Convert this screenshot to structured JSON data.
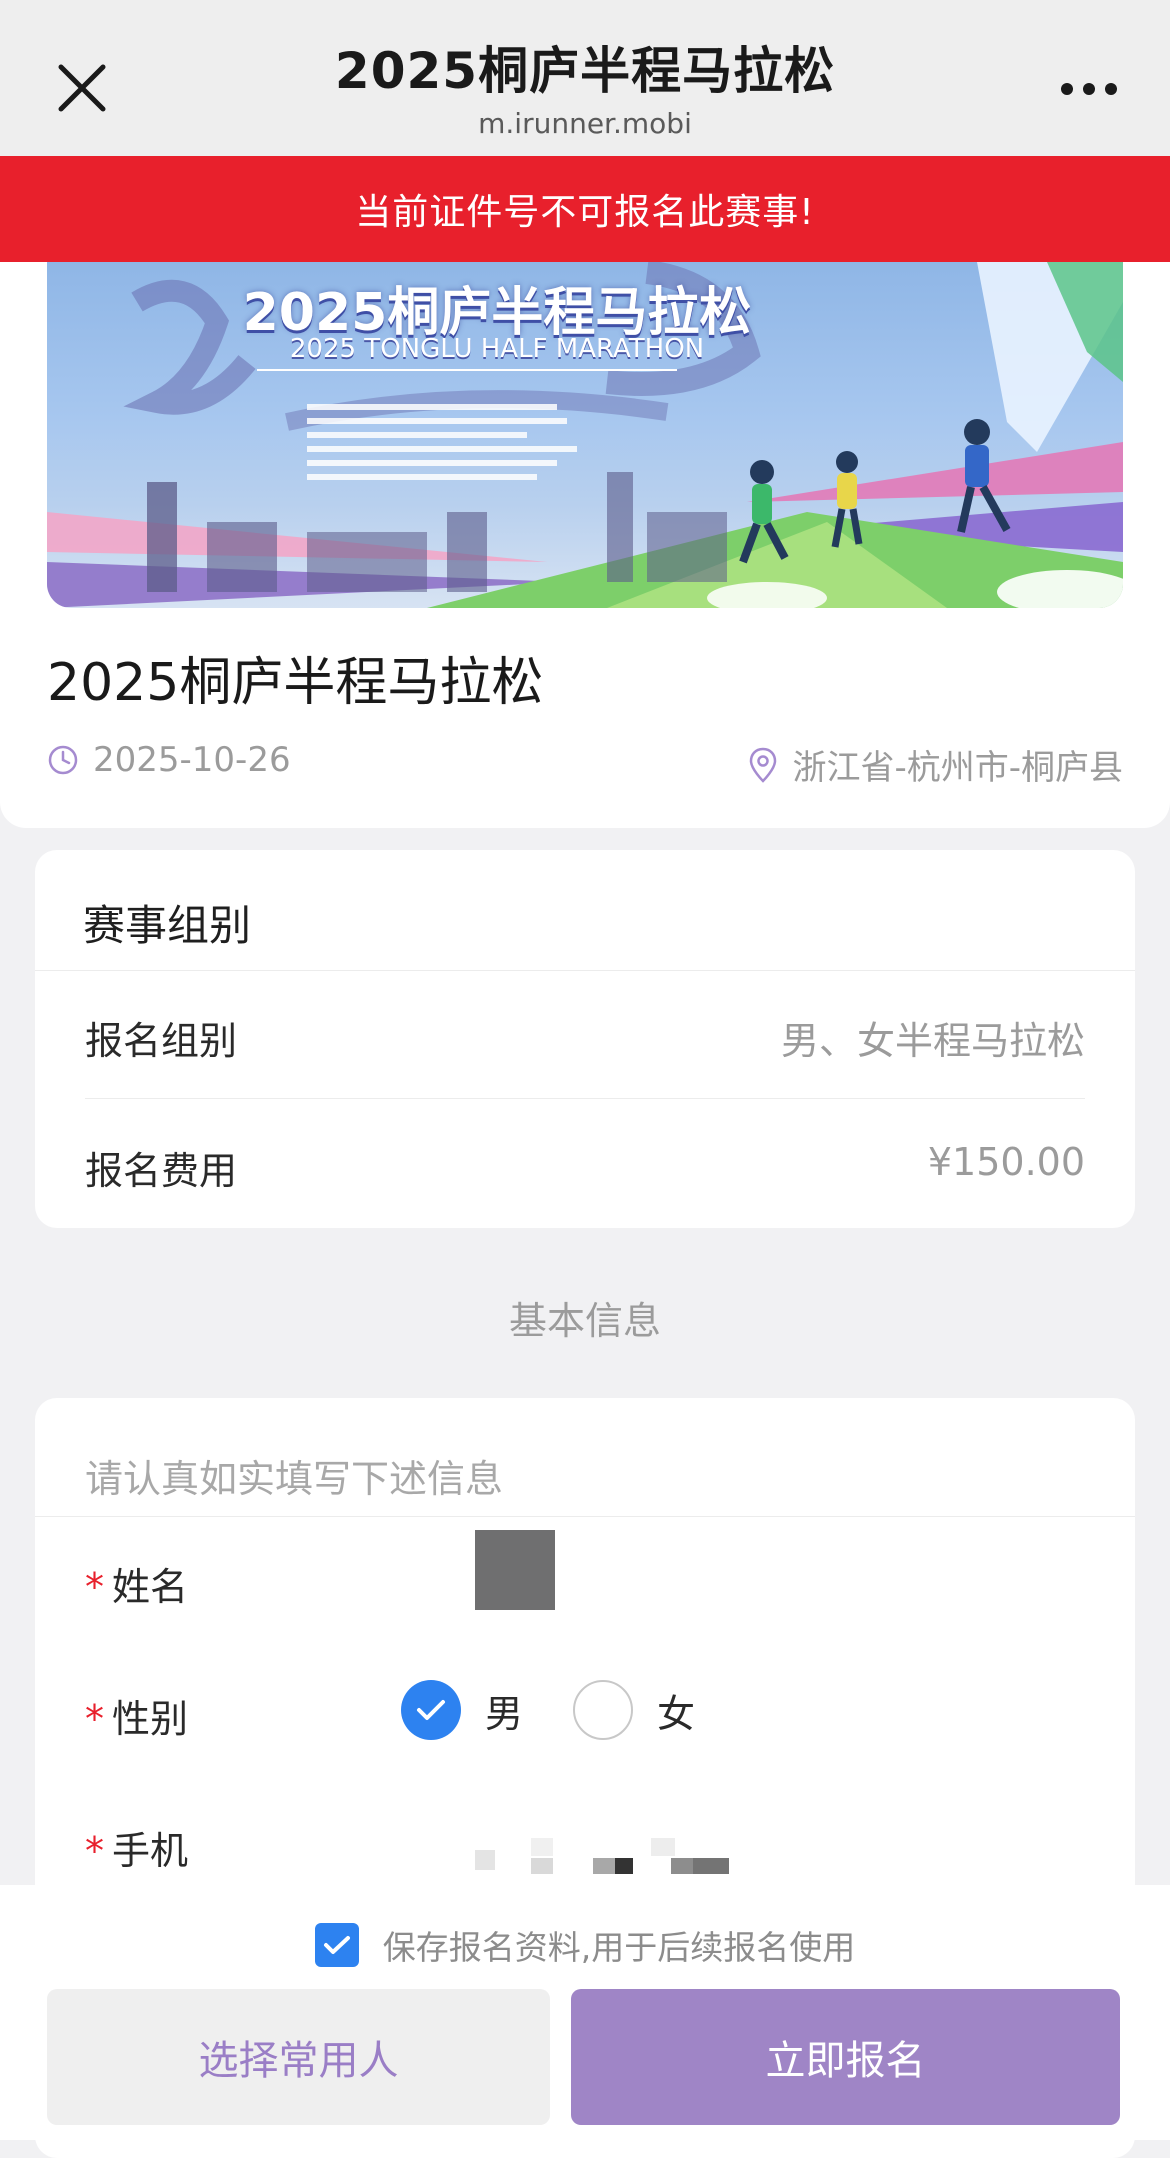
{
  "header": {
    "title": "2025桐庐半程马拉松",
    "domain": "m.irunner.mobi",
    "close_icon": "close-icon",
    "more_icon": "more-icon"
  },
  "alert": {
    "text": "当前证件号不可报名此赛事!",
    "color": "#e8202c"
  },
  "event": {
    "banner_title": "2025桐庐半程马拉松",
    "banner_subtitle": "2025 TONGLU HALF MARATHON",
    "name": "2025桐庐半程马拉松",
    "date": "2025-10-26",
    "location": "浙江省-杭州市-桐庐县",
    "date_icon": "clock-icon",
    "location_icon": "location-pin-icon"
  },
  "group_section": {
    "heading": "赛事组别",
    "rows": [
      {
        "label": "报名组别",
        "value": "男、女半程马拉松"
      },
      {
        "label": "报名费用",
        "value": "¥150.00"
      }
    ]
  },
  "basic_info": {
    "section_title": "基本信息",
    "hint": "请认真如实填写下述信息",
    "required_mark": "*",
    "fields": {
      "name_label": "姓名",
      "gender_label": "性别",
      "phone_label": "手机"
    },
    "gender_options": [
      {
        "label": "男",
        "selected": true
      },
      {
        "label": "女",
        "selected": false
      }
    ]
  },
  "footer": {
    "save_text": "保存报名资料,用于后续报名使用",
    "save_checked": true,
    "contacts_button": "选择常用人",
    "register_button": "立即报名",
    "accent": "#9f85c6",
    "check_color": "#2d82f0"
  }
}
